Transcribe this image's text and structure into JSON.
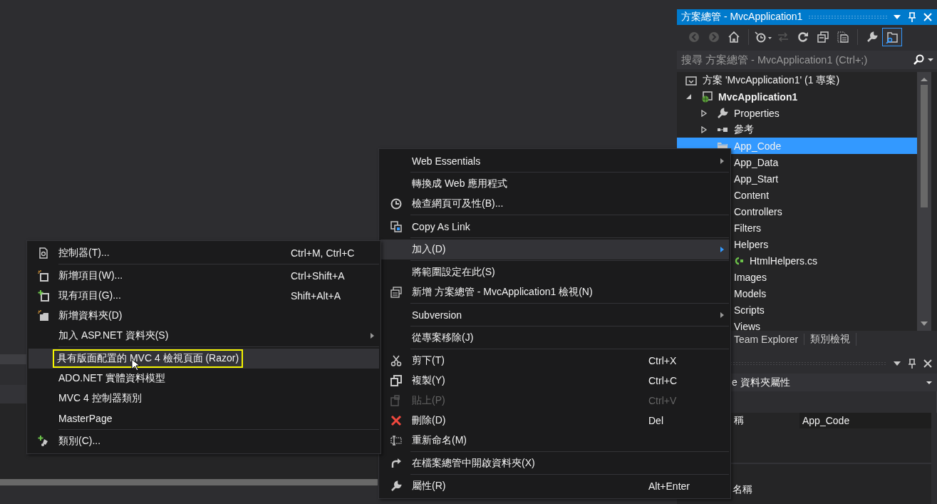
{
  "solution_explorer": {
    "title": "方案總管 - MvcApplication1",
    "toolbar": [
      {
        "disabled": true,
        "selected": false
      },
      {
        "disabled": true,
        "selected": false
      },
      {
        "disabled": false,
        "selected": false
      },
      {
        "disabled": false,
        "selected": false
      },
      {
        "disabled": true,
        "selected": false
      },
      {
        "disabled": false,
        "selected": false
      },
      {
        "disabled": false,
        "selected": false
      },
      {
        "disabled": false,
        "selected": false
      },
      {
        "disabled": false,
        "selected": false
      },
      {
        "disabled": false,
        "selected": true
      }
    ],
    "search": {
      "placeholder": "搜尋 方案總管 - MvcApplication1 (Ctrl+;)"
    },
    "tree": [
      {
        "label": "方案 'MvcApplication1' (1 專案)",
        "kind": "solution",
        "selected": false,
        "children": [
          {
            "label": "MvcApplication1",
            "kind": "project",
            "expanded": true,
            "selected": false,
            "children": [
              {
                "label": "Properties",
                "kind": "properties",
                "expanded": false,
                "selected": false
              },
              {
                "label": "參考",
                "kind": "references",
                "expanded": false,
                "selected": false
              },
              {
                "label": "App_Code",
                "kind": "folder",
                "selected": true
              },
              {
                "label": "App_Data",
                "selected": false
              },
              {
                "label": "App_Start",
                "selected": false
              },
              {
                "label": "Content",
                "selected": false
              },
              {
                "label": "Controllers",
                "selected": false
              },
              {
                "label": "Filters",
                "selected": false
              },
              {
                "label": "Helpers",
                "selected": false,
                "children": [
                  {
                    "label": "HtmlHelpers.cs",
                    "kind": "csharp-file",
                    "selected": false
                  }
                ]
              },
              {
                "label": "Images",
                "selected": false
              },
              {
                "label": "Models",
                "selected": false
              },
              {
                "label": "Scripts",
                "selected": false
              },
              {
                "label": "Views",
                "selected": false
              }
            ]
          }
        ]
      }
    ],
    "tabs": [
      {
        "label": "Team Explorer",
        "selected": false
      },
      {
        "label": "類別檢視",
        "selected": false
      }
    ]
  },
  "properties": {
    "object": "e 資料夾屬性",
    "rows": [
      {
        "name": "稱",
        "value": "App_Code"
      }
    ],
    "description": "名稱"
  },
  "context_menu": [
    {
      "kind": "item",
      "label": "Web Essentials",
      "submenu": true,
      "selected": false,
      "disabled": false
    },
    {
      "kind": "separator"
    },
    {
      "kind": "item",
      "label": "轉換成 Web 應用程式",
      "submenu": false,
      "selected": false,
      "disabled": false
    },
    {
      "kind": "item",
      "label": "檢查網頁可及性(B)...",
      "submenu": false,
      "selected": false,
      "disabled": false
    },
    {
      "kind": "separator"
    },
    {
      "kind": "item",
      "label": "Copy As Link",
      "submenu": false,
      "selected": false,
      "disabled": false
    },
    {
      "kind": "separator"
    },
    {
      "kind": "item",
      "label": "加入(D)",
      "submenu": true,
      "selected": true,
      "disabled": false
    },
    {
      "kind": "separator"
    },
    {
      "kind": "item",
      "label": "將範圍設定在此(S)",
      "submenu": false,
      "selected": false,
      "disabled": false
    },
    {
      "kind": "item",
      "label": "新增 方案總管 - MvcApplication1 檢視(N)",
      "submenu": false,
      "selected": false,
      "disabled": false
    },
    {
      "kind": "separator"
    },
    {
      "kind": "item",
      "label": "Subversion",
      "submenu": true,
      "selected": false,
      "disabled": false
    },
    {
      "kind": "separator"
    },
    {
      "kind": "item",
      "label": "從專案移除(J)",
      "submenu": false,
      "selected": false,
      "disabled": false
    },
    {
      "kind": "separator"
    },
    {
      "kind": "item",
      "label": "剪下(T)",
      "shortcut": "Ctrl+X",
      "submenu": false,
      "selected": false,
      "disabled": false
    },
    {
      "kind": "item",
      "label": "複製(Y)",
      "shortcut": "Ctrl+C",
      "submenu": false,
      "selected": false,
      "disabled": false
    },
    {
      "kind": "item",
      "label": "貼上(P)",
      "shortcut": "Ctrl+V",
      "submenu": false,
      "selected": false,
      "disabled": true
    },
    {
      "kind": "item",
      "label": "刪除(D)",
      "shortcut": "Del",
      "submenu": false,
      "selected": false,
      "disabled": false
    },
    {
      "kind": "item",
      "label": "重新命名(M)",
      "submenu": false,
      "selected": false,
      "disabled": false
    },
    {
      "kind": "separator"
    },
    {
      "kind": "item",
      "label": "在檔案總管中開啟資料夾(X)",
      "submenu": false,
      "selected": false,
      "disabled": false
    },
    {
      "kind": "separator"
    },
    {
      "kind": "item",
      "label": "屬性(R)",
      "shortcut": "Alt+Enter",
      "submenu": false,
      "selected": false,
      "disabled": false
    }
  ],
  "add_submenu": [
    {
      "kind": "item",
      "label": "控制器(T)...",
      "shortcut": "Ctrl+M, Ctrl+C",
      "submenu": false,
      "selected": false,
      "outlined": false
    },
    {
      "kind": "separator"
    },
    {
      "kind": "item",
      "label": "新增項目(W)...",
      "shortcut": "Ctrl+Shift+A",
      "submenu": false,
      "selected": false,
      "outlined": false
    },
    {
      "kind": "item",
      "label": "現有項目(G)...",
      "shortcut": "Shift+Alt+A",
      "submenu": false,
      "selected": false,
      "outlined": false
    },
    {
      "kind": "item",
      "label": "新增資料夾(D)",
      "submenu": false,
      "selected": false,
      "outlined": false
    },
    {
      "kind": "item",
      "label": "加入 ASP.NET 資料夾(S)",
      "submenu": true,
      "selected": false,
      "outlined": false
    },
    {
      "kind": "separator"
    },
    {
      "kind": "item",
      "label": "具有版面配置的 MVC 4 檢視頁面 (Razor)",
      "submenu": false,
      "selected": true,
      "outlined": true
    },
    {
      "kind": "item",
      "label": "ADO.NET 實體資料模型",
      "submenu": false,
      "selected": false,
      "outlined": false
    },
    {
      "kind": "item",
      "label": "MVC 4 控制器類別",
      "submenu": false,
      "selected": false,
      "outlined": false
    },
    {
      "kind": "item",
      "label": "MasterPage",
      "submenu": false,
      "selected": false,
      "outlined": false
    },
    {
      "kind": "separator"
    },
    {
      "kind": "item",
      "label": "類別(C)...",
      "submenu": false,
      "selected": false,
      "outlined": false
    }
  ]
}
